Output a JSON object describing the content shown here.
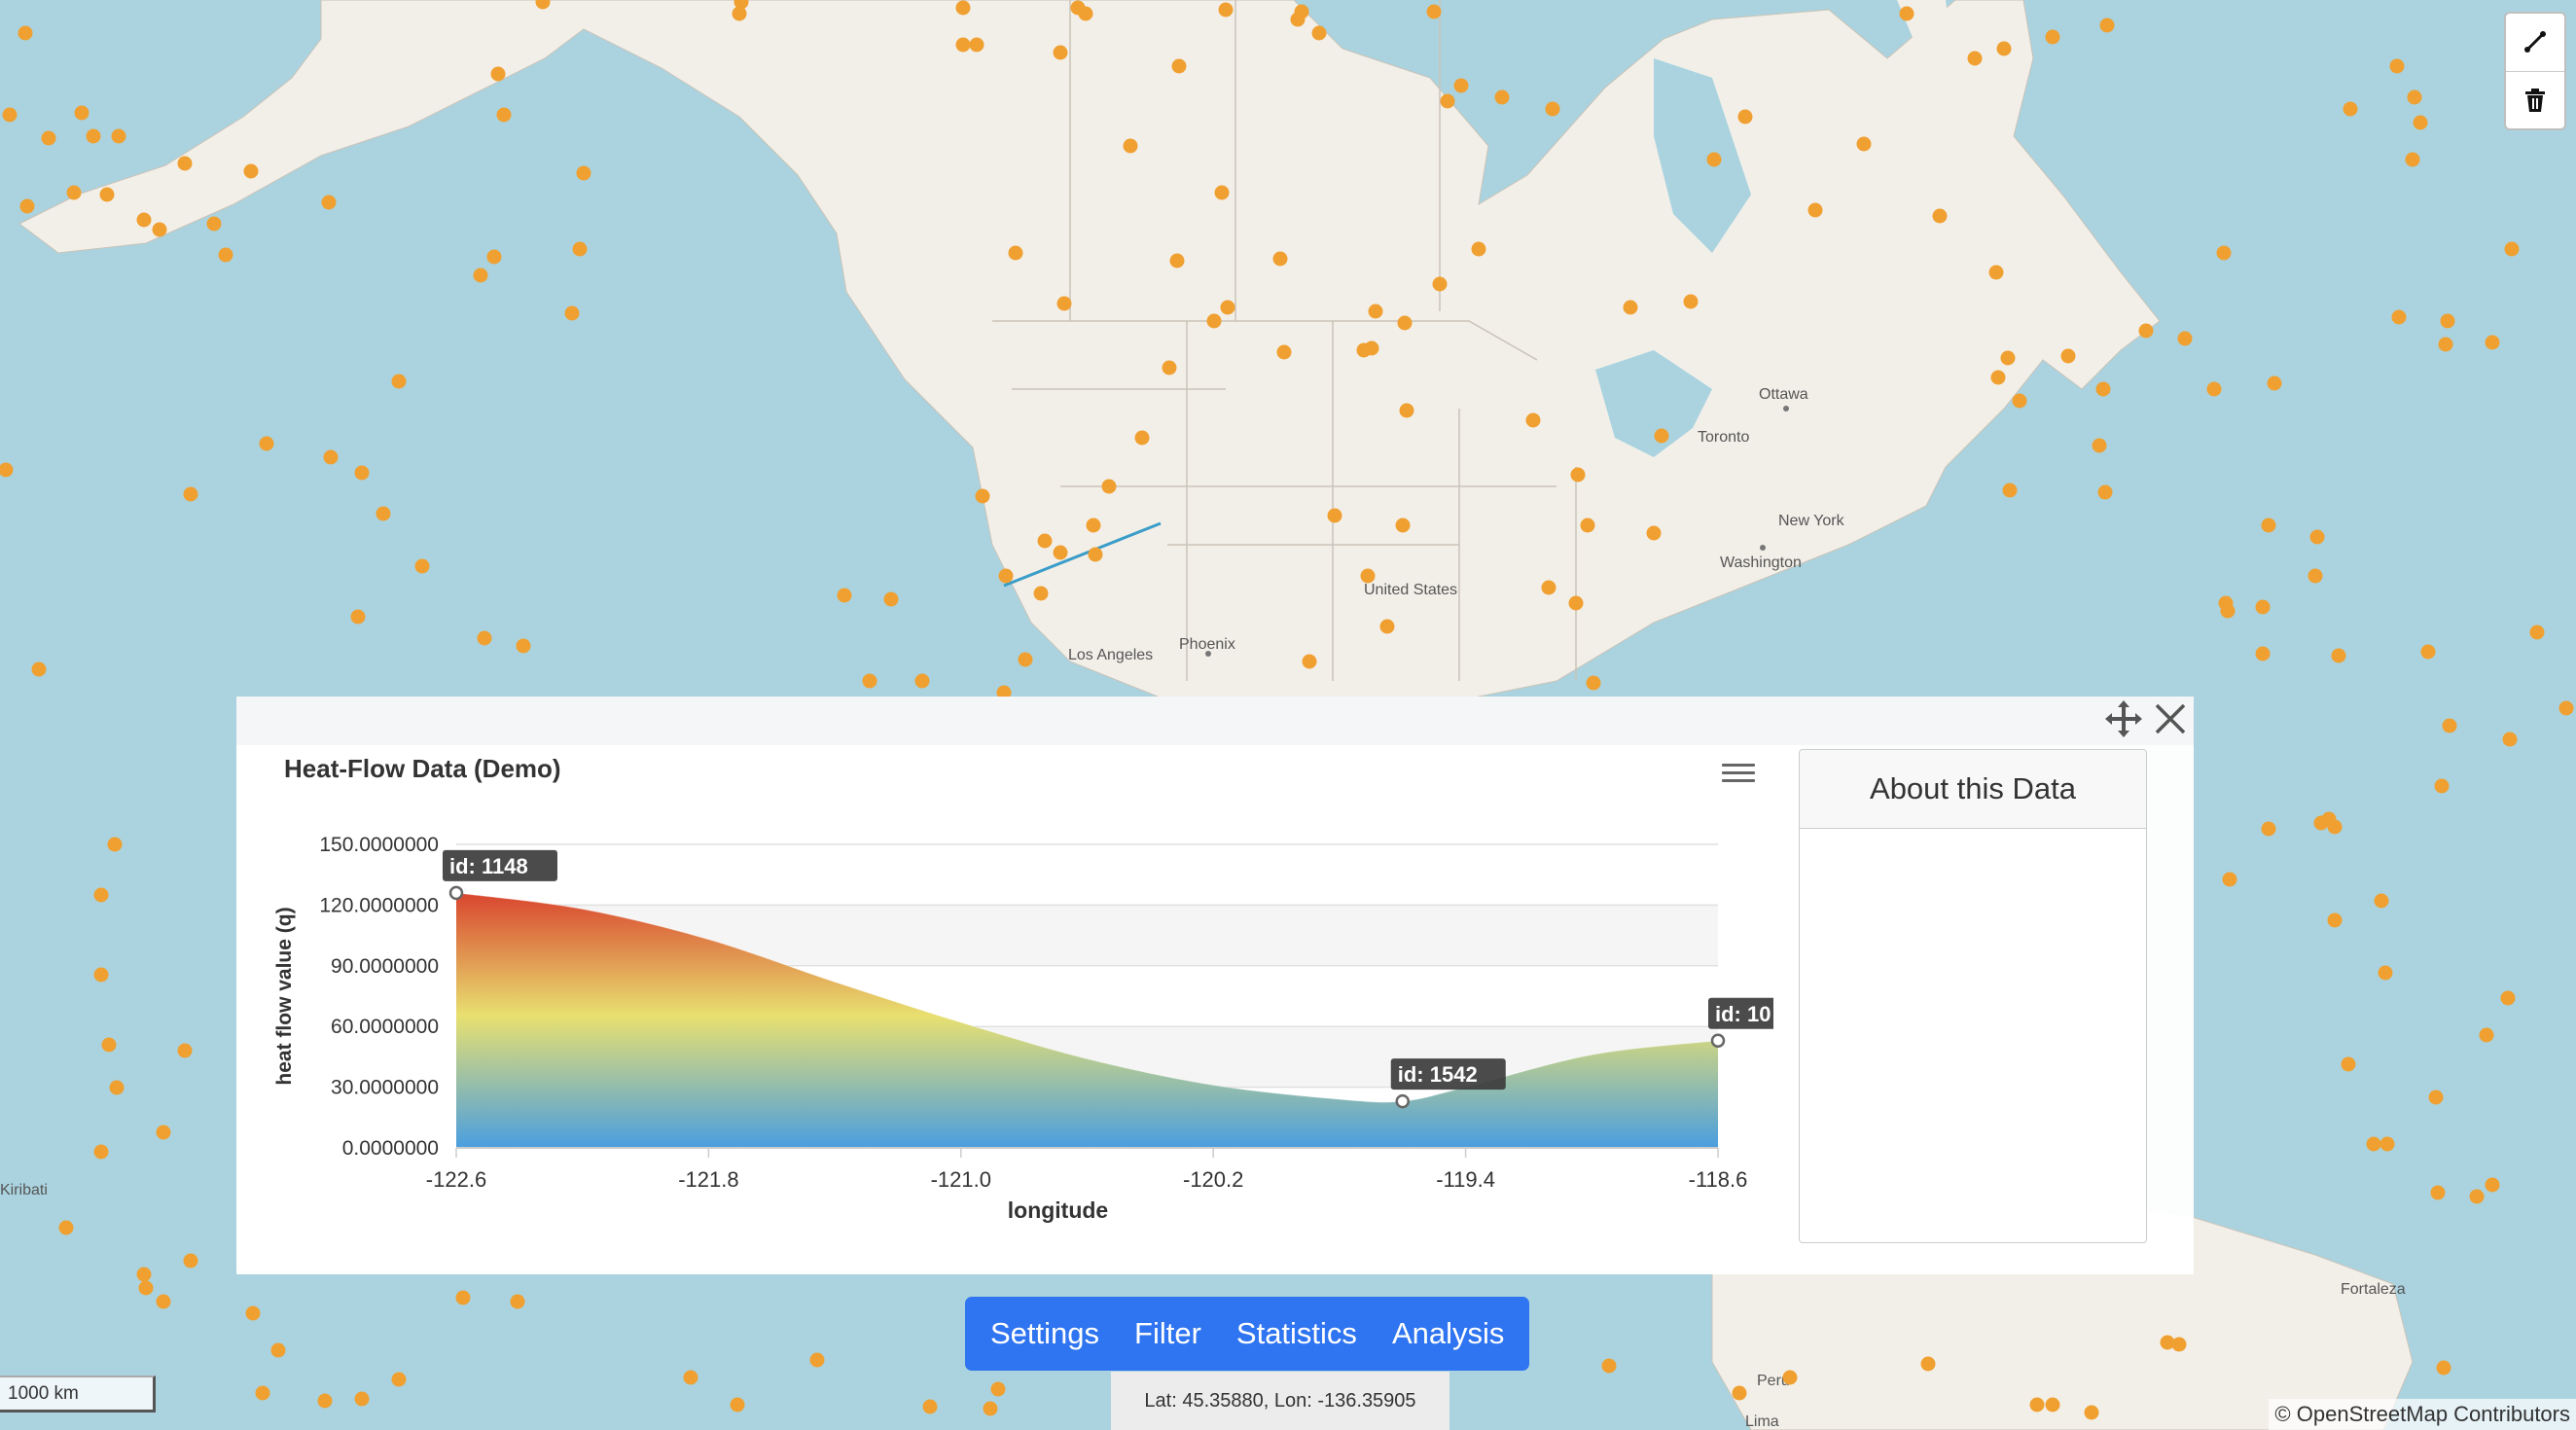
{
  "map": {
    "labels": {
      "ottawa": "Ottawa",
      "toronto": "Toronto",
      "new_york": "New York",
      "washington": "Washington",
      "united_states": "United States",
      "phoenix": "Phoenix",
      "los_angeles": "Los Angeles",
      "kiribati": "Kiribati",
      "fortaleza": "Fortaleza",
      "lima": "Lima",
      "peru": "Peru"
    },
    "colors": {
      "water": "#aad3df",
      "land": "#f2efe9",
      "point": "#f0a030",
      "profile_line": "#3a9dc8"
    }
  },
  "toolbar": {
    "draw_line_icon": "draw-line-icon",
    "delete_icon": "trash-icon"
  },
  "panel": {
    "move_icon": "move-icon",
    "close_icon": "close-icon",
    "menu_icon": "hamburger-menu-icon",
    "about_title": "About this Data"
  },
  "chart_data": {
    "type": "area",
    "title": "Heat-Flow Data (Demo)",
    "xlabel": "longitude",
    "ylabel": "heat flow value (q)",
    "xlim": [
      -122.6,
      -118.6
    ],
    "ylim": [
      0,
      150
    ],
    "x_ticks": [
      "-122.6",
      "-121.8",
      "-121.0",
      "-120.2",
      "-119.4",
      "-118.6"
    ],
    "y_ticks": [
      "0.0000000",
      "30.0000000",
      "60.0000000",
      "90.0000000",
      "120.0000000",
      "150.0000000"
    ],
    "grid": true,
    "gradient": [
      "#4a9ee0",
      "#e8e070",
      "#d83a2a"
    ],
    "series": [
      {
        "values": [
          {
            "x": -122.6,
            "y": 126
          },
          {
            "x": -122.2,
            "y": 118
          },
          {
            "x": -121.8,
            "y": 103
          },
          {
            "x": -121.4,
            "y": 82
          },
          {
            "x": -121.0,
            "y": 62
          },
          {
            "x": -120.6,
            "y": 44
          },
          {
            "x": -120.2,
            "y": 31
          },
          {
            "x": -119.8,
            "y": 24
          },
          {
            "x": -119.6,
            "y": 23
          },
          {
            "x": -119.4,
            "y": 30
          },
          {
            "x": -119.0,
            "y": 46
          },
          {
            "x": -118.6,
            "y": 53
          }
        ]
      }
    ],
    "annotations": [
      {
        "x": -122.6,
        "y": 126,
        "label": "id: 1148"
      },
      {
        "x": -119.6,
        "y": 23,
        "label": "id: 1542"
      },
      {
        "x": -118.6,
        "y": 53,
        "label": "id: 10"
      }
    ]
  },
  "nav": {
    "items": [
      "Settings",
      "Filter",
      "Statistics",
      "Analysis"
    ]
  },
  "status": {
    "coords": "Lat: 45.35880, Lon: -136.35905",
    "scale": "1000 km",
    "attribution": "© OpenStreetMap Contributors"
  }
}
